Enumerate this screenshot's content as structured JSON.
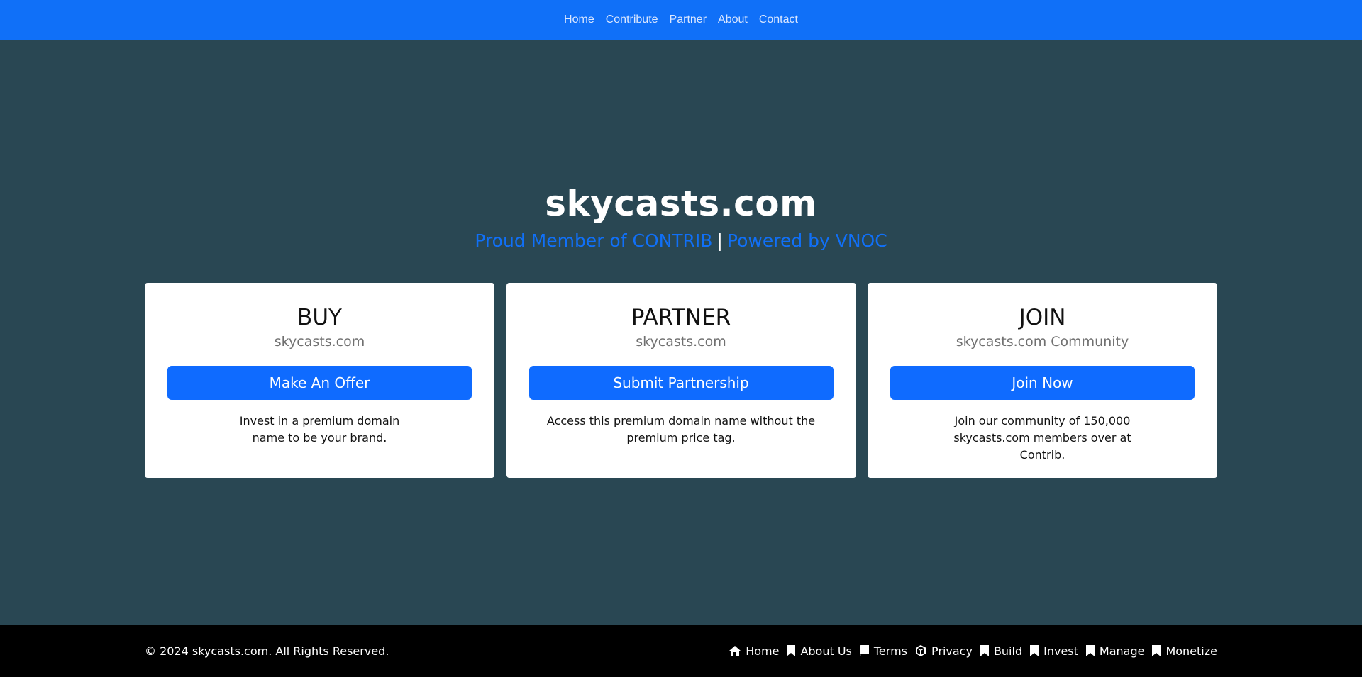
{
  "nav": {
    "items": [
      "Home",
      "Contribute",
      "Partner",
      "About",
      "Contact"
    ]
  },
  "hero": {
    "title": "skycasts.com",
    "member_link": "Proud Member of CONTRIB",
    "separator": "|",
    "powered_link": "Powered by VNOC"
  },
  "cards": [
    {
      "title": "BUY",
      "subtitle": "skycasts.com",
      "button": "Make An Offer",
      "description": "Invest in a premium domain name to be your brand."
    },
    {
      "title": "PARTNER",
      "subtitle": "skycasts.com",
      "button": "Submit Partnership",
      "description": "Access this premium domain name without the premium price tag."
    },
    {
      "title": "JOIN",
      "subtitle": "skycasts.com Community",
      "button": "Join Now",
      "description": "Join our community of 150,000 skycasts.com members over at Contrib."
    }
  ],
  "footer": {
    "copyright": "© 2024 skycasts.com. All Rights Reserved.",
    "links": [
      {
        "label": "Home",
        "icon": "home-icon"
      },
      {
        "label": "About Us",
        "icon": "bookmark-icon"
      },
      {
        "label": "Terms",
        "icon": "book-icon"
      },
      {
        "label": "Privacy",
        "icon": "cube-icon"
      },
      {
        "label": "Build",
        "icon": "bookmark-icon"
      },
      {
        "label": "Invest",
        "icon": "bookmark-icon"
      },
      {
        "label": "Manage",
        "icon": "bookmark-icon"
      },
      {
        "label": "Monetize",
        "icon": "bookmark-icon"
      }
    ]
  },
  "colors": {
    "nav_bg": "#1070f8",
    "page_bg": "#294753",
    "accent": "#0f6bff",
    "footer_bg": "#000000"
  }
}
